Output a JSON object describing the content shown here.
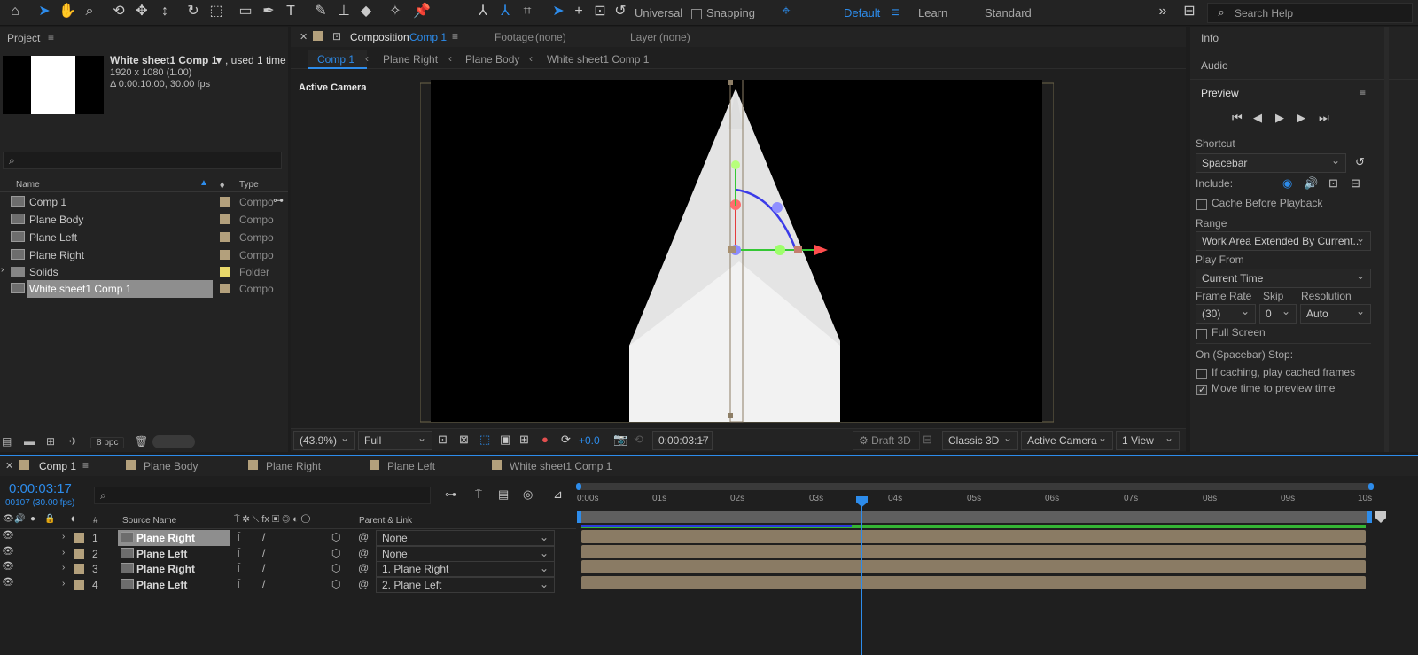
{
  "toolbar": {
    "tools": [
      "home-icon",
      "selection-arrow-icon",
      "hand-icon",
      "zoom-icon",
      "orbit-camera-icon",
      "pan-camera-icon",
      "dolly-camera-icon",
      "rotate-icon",
      "unified-camera-icon",
      "rectangle-icon",
      "pen-icon",
      "type-icon",
      "brush-icon",
      "clone-stamp-icon",
      "eraser-icon",
      "roto-brush-icon",
      "puppet-pin-icon"
    ],
    "axis_mode_label": "Universal",
    "snapping_label": "Snapping",
    "workspaces": [
      "Default",
      "Learn",
      "Standard"
    ],
    "active_workspace": "Default",
    "search_placeholder": "Search Help"
  },
  "project": {
    "title": "Project",
    "comp_name": "White sheet1 Comp 1",
    "comp_used": ", used 1 time",
    "comp_size": "1920 x 1080 (1.00)",
    "comp_duration": "Δ 0:00:10:00, 30.00 fps",
    "search_icon": "search-icon",
    "columns": {
      "name": "Name",
      "type": "Type"
    },
    "items": [
      {
        "name": "Comp 1",
        "type": "Compo"
      },
      {
        "name": "Plane Body",
        "type": "Compo"
      },
      {
        "name": "Plane Left",
        "type": "Compo"
      },
      {
        "name": "Plane Right",
        "type": "Compo"
      },
      {
        "name": "Solids",
        "type": "Folder"
      },
      {
        "name": "White sheet1 Comp 1",
        "type": "Compo"
      }
    ],
    "bpc": "8 bpc"
  },
  "composition": {
    "tab_label": "Composition",
    "tab_comp": "Comp 1",
    "footage": "Footage",
    "footage_value": "(none)",
    "layer": "Layer",
    "layer_value": "(none)",
    "breadcrumbs": [
      "Comp 1",
      "Plane Right",
      "Plane Body",
      "White sheet1 Comp 1"
    ],
    "camera_label": "Active Camera",
    "zoom": "(43.9%)",
    "resolution": "Full",
    "exposure": "+0.0",
    "timecode": "0:00:03:17",
    "draft": "Draft 3D",
    "renderer": "Classic 3D",
    "camera": "Active Camera",
    "views": "1 View"
  },
  "right_panel": {
    "info": "Info",
    "audio": "Audio",
    "preview": "Preview",
    "shortcut_label": "Shortcut",
    "shortcut_value": "Spacebar",
    "include_label": "Include:",
    "cache_label": "Cache Before Playback",
    "range_label": "Range",
    "range_value": "Work Area Extended By Current...",
    "play_from_label": "Play From",
    "play_from_value": "Current Time",
    "frame_rate_label": "Frame Rate",
    "skip_label": "Skip",
    "resolution_label": "Resolution",
    "frame_rate_value": "(30)",
    "skip_value": "0",
    "resolution_value": "Auto",
    "full_screen_label": "Full Screen",
    "stop_label": "On (Spacebar) Stop:",
    "if_caching_label": "If caching, play cached frames",
    "move_time_label": "Move time to preview time"
  },
  "timeline": {
    "tabs": [
      "Comp 1",
      "Plane Body",
      "Plane Right",
      "Plane Left",
      "White sheet1 Comp 1"
    ],
    "timecode": "0:00:03:17",
    "frames": "00107 (30.00 fps)",
    "columns": {
      "num": "#",
      "source": "Source Name",
      "parent": "Parent & Link"
    },
    "ruler": [
      "0:00s",
      "01s",
      "02s",
      "03s",
      "04s",
      "05s",
      "06s",
      "07s",
      "08s",
      "09s",
      "10s"
    ],
    "layers": [
      {
        "num": "1",
        "name": "Plane Right",
        "parent": "None"
      },
      {
        "num": "2",
        "name": "Plane Left",
        "parent": "None"
      },
      {
        "num": "3",
        "name": "Plane Right",
        "parent": "1. Plane Right"
      },
      {
        "num": "4",
        "name": "Plane Left",
        "parent": "2. Plane Left"
      }
    ]
  },
  "colors": {
    "accent": "#2d8ceb",
    "label_tan": "#b3a07c",
    "folder": "#e8d86a"
  }
}
